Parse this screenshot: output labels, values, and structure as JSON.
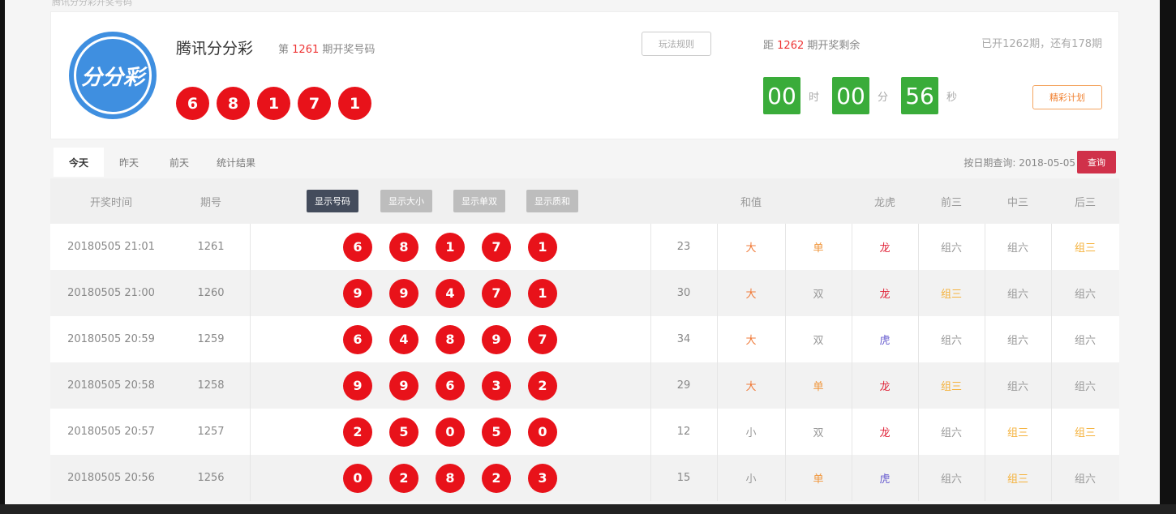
{
  "breadcrumb": "腾讯分分彩开奖号码",
  "header": {
    "logo_text": "分分彩",
    "game_title": "腾讯分分彩",
    "issue_prefix": "第",
    "issue_number": "1261",
    "issue_suffix": "期开奖号码",
    "winning_numbers": [
      "6",
      "8",
      "1",
      "7",
      "1"
    ],
    "rules_button": "玩法规则",
    "next_prefix": "距",
    "next_issue": "1262",
    "next_suffix": "期开奖剩余",
    "opened_text": "已开1262期，还有178期",
    "countdown": {
      "hours": "00",
      "hours_unit": "时",
      "minutes": "00",
      "minutes_unit": "分",
      "seconds": "56",
      "seconds_unit": "秒"
    },
    "plan_button": "精彩计划"
  },
  "tabs": [
    "今天",
    "昨天",
    "前天",
    "统计结果"
  ],
  "date_query": {
    "label": "按日期查询:",
    "date": "2018-05-05",
    "button": "查询"
  },
  "table": {
    "headers": {
      "time": "开奖时间",
      "issue": "期号",
      "sum": "和值",
      "dragon_tiger": "龙虎",
      "front3": "前三",
      "mid3": "中三",
      "back3": "后三"
    },
    "show_buttons": [
      "显示号码",
      "显示大小",
      "显示单双",
      "显示质和"
    ],
    "rows": [
      {
        "time": "20180505 21:01",
        "issue": "1261",
        "balls": [
          "6",
          "8",
          "1",
          "7",
          "1"
        ],
        "sum": "23",
        "size": "大",
        "parity": "单",
        "dt": "龙",
        "f3": "组六",
        "m3": "组六",
        "b3": "组三"
      },
      {
        "time": "20180505 21:00",
        "issue": "1260",
        "balls": [
          "9",
          "9",
          "4",
          "7",
          "1"
        ],
        "sum": "30",
        "size": "大",
        "parity": "双",
        "dt": "龙",
        "f3": "组三",
        "m3": "组六",
        "b3": "组六"
      },
      {
        "time": "20180505 20:59",
        "issue": "1259",
        "balls": [
          "6",
          "4",
          "8",
          "9",
          "7"
        ],
        "sum": "34",
        "size": "大",
        "parity": "双",
        "dt": "虎",
        "f3": "组六",
        "m3": "组六",
        "b3": "组六"
      },
      {
        "time": "20180505 20:58",
        "issue": "1258",
        "balls": [
          "9",
          "9",
          "6",
          "3",
          "2"
        ],
        "sum": "29",
        "size": "大",
        "parity": "单",
        "dt": "龙",
        "f3": "组三",
        "m3": "组六",
        "b3": "组六"
      },
      {
        "time": "20180505 20:57",
        "issue": "1257",
        "balls": [
          "2",
          "5",
          "0",
          "5",
          "0"
        ],
        "sum": "12",
        "size": "小",
        "parity": "双",
        "dt": "龙",
        "f3": "组六",
        "m3": "组三",
        "b3": "组三"
      },
      {
        "time": "20180505 20:56",
        "issue": "1256",
        "balls": [
          "0",
          "2",
          "8",
          "2",
          "3"
        ],
        "sum": "15",
        "size": "小",
        "parity": "单",
        "dt": "虎",
        "f3": "组六",
        "m3": "组三",
        "b3": "组六"
      }
    ]
  }
}
